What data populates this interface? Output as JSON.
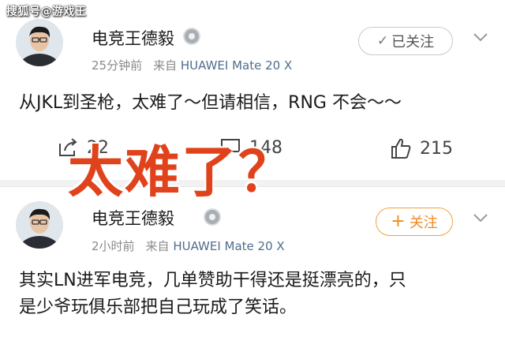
{
  "watermark": "搜狐号@游戏王",
  "overlay": "太难了？",
  "posts": [
    {
      "username": "电竞王德毅",
      "time": "25分钟前",
      "source_prefix": "来自",
      "device": "HUAWEI Mate 20 X",
      "follow_label": "已关注",
      "content": "从JKL到圣枪，太难了～但请相信，RNG 不会～～",
      "actions": {
        "repost_count": "22",
        "comment_count": "148",
        "like_count": "215"
      }
    },
    {
      "username": "电竞王德毅",
      "time": "2小时前",
      "source_prefix": "来自",
      "device": "HUAWEI Mate 20 X",
      "follow_label": "关注",
      "content_line1": "其实LN进军电竞，几单赞助干得还是挺漂亮的，只",
      "content_line2": "是少爷玩俱乐部把自己玩成了笑话。"
    }
  ]
}
